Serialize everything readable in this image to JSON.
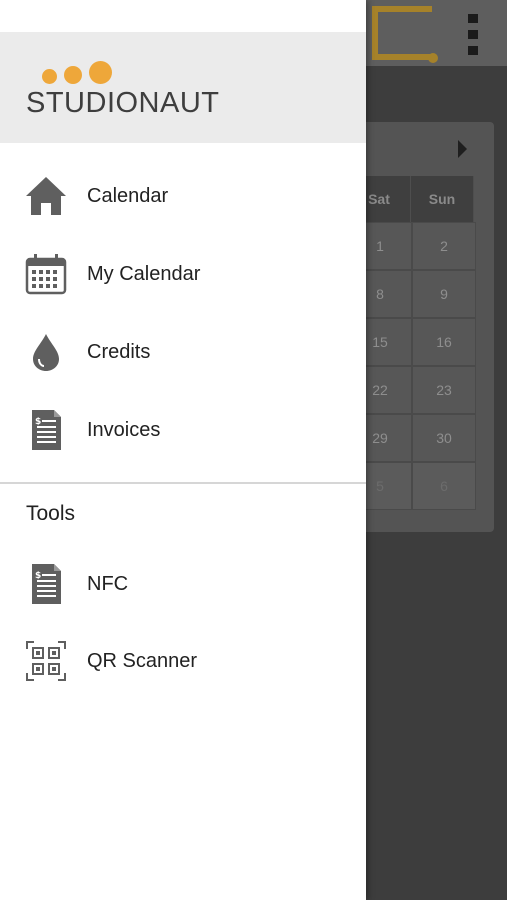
{
  "brand": {
    "name": "STUDIONAUT",
    "accent": "#eea73a"
  },
  "menu": {
    "items": [
      {
        "label": "Calendar",
        "icon": "home-icon"
      },
      {
        "label": "My Calendar",
        "icon": "calendar-icon"
      },
      {
        "label": "Credits",
        "icon": "drop-icon"
      },
      {
        "label": "Invoices",
        "icon": "invoice-icon"
      }
    ]
  },
  "tools": {
    "title": "Tools",
    "items": [
      {
        "label": "NFC",
        "icon": "invoice-icon"
      },
      {
        "label": "QR Scanner",
        "icon": "qr-icon"
      }
    ]
  },
  "background_calendar": {
    "headers": [
      "Sat",
      "Sun"
    ],
    "rows": [
      [
        "1",
        "2"
      ],
      [
        "8",
        "9"
      ],
      [
        "15",
        "16"
      ],
      [
        "22",
        "23"
      ],
      [
        "29",
        "30"
      ],
      [
        "5",
        "6"
      ]
    ]
  }
}
